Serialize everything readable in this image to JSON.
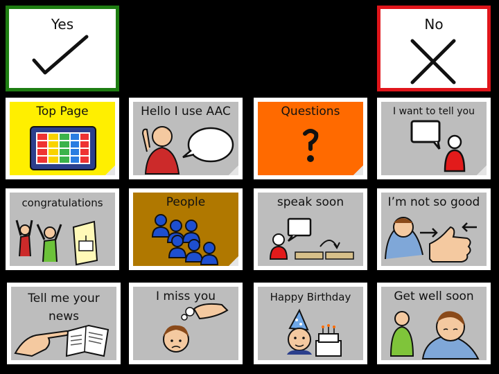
{
  "colors": {
    "yes_border": "#1e7d12",
    "no_border": "#e0151b",
    "yellow": "#ffef00",
    "orange": "#ff6a00",
    "brown": "#b07800",
    "grey": "#bdbdbd"
  },
  "yes": {
    "label": "Yes",
    "icon": "check-icon"
  },
  "no": {
    "label": "No",
    "icon": "cross-icon"
  },
  "tiles": [
    {
      "label": "Top Page",
      "icon": "grid-board-icon"
    },
    {
      "label": "Hello I use AAC",
      "icon": "person-speech-bubble-icon"
    },
    {
      "label": "Questions",
      "icon": "question-mark-icon"
    },
    {
      "label": "I want to tell you",
      "icon": "person-speech-bubble-icon"
    },
    {
      "label": "congratulations",
      "icon": "celebration-card-icon"
    },
    {
      "label": "People",
      "icon": "group-of-people-icon"
    },
    {
      "label": "speak soon",
      "icon": "speak-later-icon"
    },
    {
      "label": "I’m not so good",
      "icon": "thumbs-down-icon"
    },
    {
      "label": "Tell me your news",
      "icon": "newspaper-point-icon"
    },
    {
      "label": "I miss you",
      "icon": "person-thinking-icon"
    },
    {
      "label": "Happy Birthday",
      "icon": "birthday-cake-icon"
    },
    {
      "label": "Get well soon",
      "icon": "sick-person-icon"
    }
  ]
}
